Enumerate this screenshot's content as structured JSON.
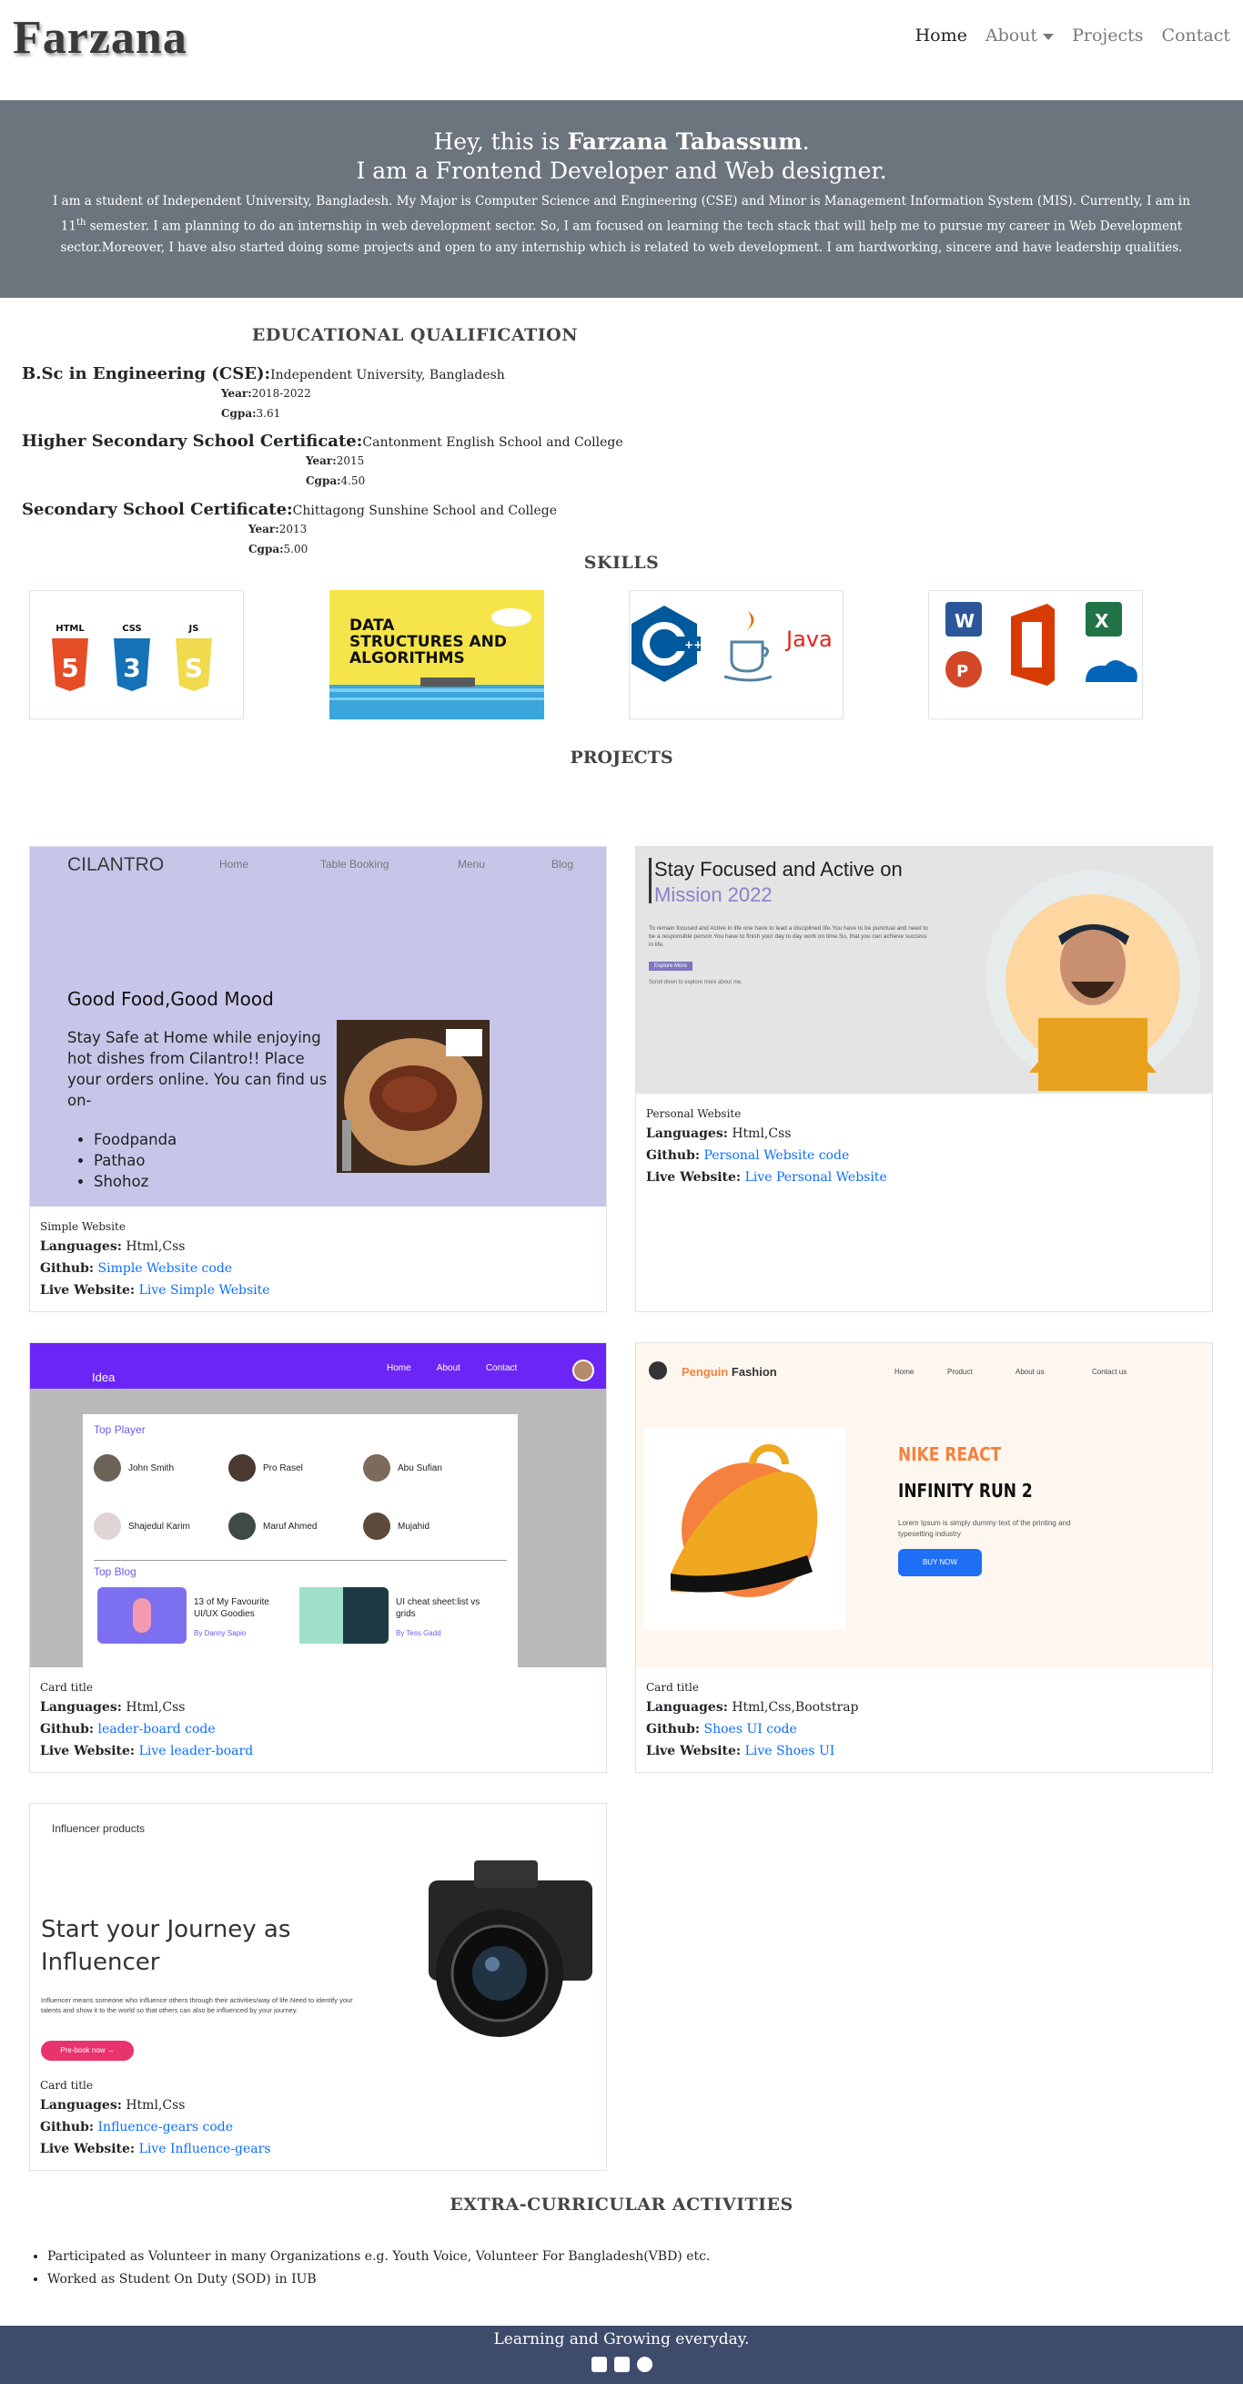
{
  "brand": "Farzana",
  "nav": {
    "home": "Home",
    "about": "About",
    "projects": "Projects",
    "contact": "Contact"
  },
  "hero": {
    "greeting": "Hey, this is",
    "name": "Farzana Tabassum",
    "punct": ".",
    "role": "I am a Frontend Developer and Web designer.",
    "bio_1": "I am a student of Independent University, Bangladesh. My Major is Computer Science and Engineering (CSE) and Minor is Management Information System (MIS). Currently, I am in 11",
    "bio_sup": "th",
    "bio_2": " semester. I am planning to do an internship in web development sector. So, I am focused on learning the tech stack that will help me to pursue my career in Web Development sector.Moreover, I have also started doing some projects and open to any internship which is related to web development. I am hardworking, sincere and have leadership qualities."
  },
  "education": {
    "title": "EDUCATIONAL QUALIFICATION",
    "items": [
      {
        "degree": "B.Sc in Engineering (CSE):",
        "school": "Independent University, Bangladesh",
        "year_label": "Year:",
        "year": "2018-2022",
        "cgpa_label": "Cgpa:",
        "cgpa": "3.61"
      },
      {
        "degree": "Higher Secondary School Certificate:",
        "school": "Cantonment English School and College",
        "year_label": "Year:",
        "year": "2015",
        "cgpa_label": "Cgpa:",
        "cgpa": "4.50"
      },
      {
        "degree": "Secondary School Certificate:",
        "school": "Chittagong Sunshine School and College",
        "year_label": "Year:",
        "year": "2013",
        "cgpa_label": "Cgpa:",
        "cgpa": "5.00"
      }
    ]
  },
  "skills": {
    "title": "SKILLS",
    "web": [
      "HTML",
      "CSS",
      "JS"
    ],
    "dsa": "DATA STRUCTURES AND ALGORITHMS",
    "java": "Java"
  },
  "projects": {
    "title": "PROJECTS",
    "lang_label": "Languages:",
    "gh_label": "Github:",
    "live_label": "Live Website:",
    "items": [
      {
        "card_title": "Simple Website",
        "languages": "Html,Css",
        "github": "Simple Website code",
        "live": "Live Simple Website"
      },
      {
        "card_title": "Personal Website",
        "languages": "Html,Css",
        "github": "Personal Website code",
        "live": "Live Personal Website"
      },
      {
        "card_title": "Card title",
        "languages": "Html,Css",
        "github": "leader-board code",
        "live": "Live leader-board"
      },
      {
        "card_title": "Card title",
        "languages": "Html,Css,Bootstrap",
        "github": "Shoes UI code",
        "live": "Live Shoes UI"
      },
      {
        "card_title": "Card title",
        "languages": "Html,Css",
        "github": "Influence-gears code",
        "live": "Live Influence-gears"
      }
    ],
    "shots": {
      "cilantro": {
        "brand": "CILANTRO",
        "nav": [
          "Home",
          "Table Booking",
          "Menu",
          "Blog"
        ],
        "headline": "Good Food,Good Mood",
        "text": "Stay Safe at Home while enjoying hot dishes from Cilantro!! Place your orders online. You can find us on-",
        "list": [
          "Foodpanda",
          "Pathao",
          "Shohoz"
        ]
      },
      "personal": {
        "h1": "Stay Focused and Active on",
        "h2": "Mission 2022",
        "p": "To remain focused and Active in life one have to lead a disciplined life.You have to be punctual and need to be a responsible person.You have to finish your day to day work on time.So, that you can achieve success in life.",
        "btn": "Explore More",
        "small": "Scroll down to explore more about me."
      },
      "leader": {
        "brand": "Idea",
        "nav": [
          "Home",
          "About",
          "Contact"
        ],
        "top": "Top Player",
        "players": [
          "John Smith",
          "Pro Rasel",
          "Abu Sufian",
          "Shajedul Karim",
          "Maruf Ahmed",
          "Mujahid"
        ],
        "blog": "Top Blog",
        "post1": "13 of My Favourite UI/UX Goodies",
        "by1": "By Danny Sapio",
        "post2": "UI cheat sheet:list vs grids",
        "by2": "By Tess Gadd"
      },
      "shoes": {
        "brand1": "Penguin",
        "brand2": "Fashion",
        "nav": [
          "Home",
          "Product",
          "About us",
          "Contact us"
        ],
        "h1": "NIKE REACT",
        "h2": "INFINITY RUN 2",
        "p": "Lorem Ipsum is simply dummy text of the printing and typesetting industry",
        "btn": "BUY NOW"
      },
      "influence": {
        "brand": "Influencer products",
        "h": "Start your Journey as Influencer",
        "p": "Influencer means someone who influence others through their activities/way of life.Need to identify your talents and show it to the world so that others can also be influenced by your journey.",
        "btn": "Pre-book now →"
      }
    }
  },
  "extra": {
    "title": "EXTRA-CURRICULAR ACTIVITIES",
    "items": [
      "Participated as Volunteer in many Organizations e.g. Youth Voice, Volunteer For Bangladesh(VBD) etc.",
      "Worked as Student On Duty (SOD) in IUB"
    ]
  },
  "footer": {
    "text": "Learning and Growing everyday."
  },
  "colors": {
    "hero_bg": "#6c757d",
    "footer_bg": "#3f4b6b",
    "link": "#0d6efd"
  }
}
